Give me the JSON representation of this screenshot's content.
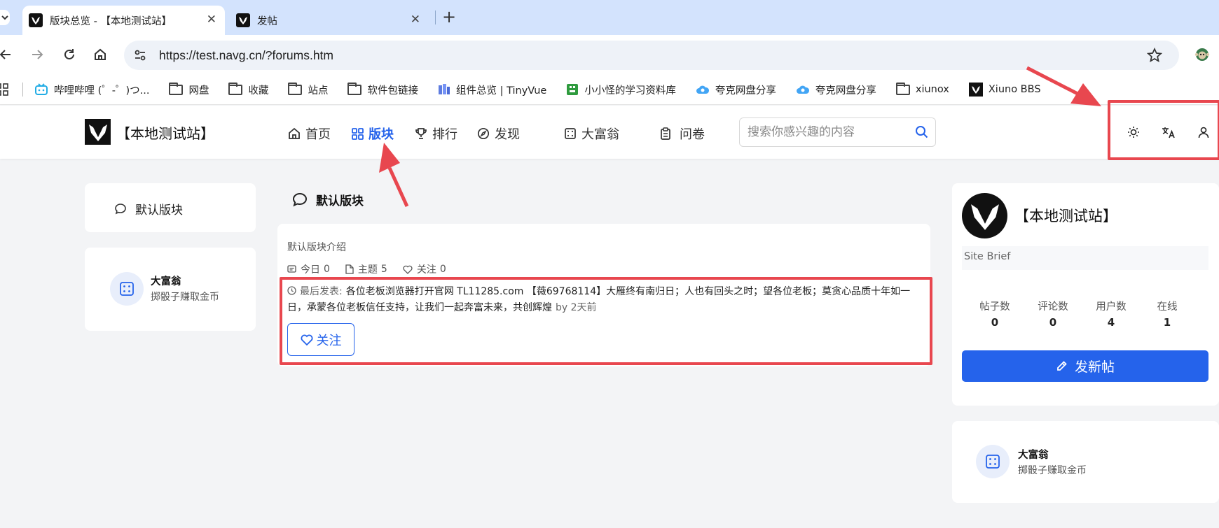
{
  "browser": {
    "tabs": [
      {
        "title": "版块总览 - 【本地测试站】",
        "active": true
      },
      {
        "title": "发帖",
        "active": false
      }
    ],
    "new_tab_symbol": "+",
    "close_symbol": "✕",
    "url": "https://test.navg.cn/?forums.htm",
    "bookmarks": [
      {
        "icon": "bilibili-icon",
        "label": "哔哩哔哩 (゜-゜)つ..."
      },
      {
        "icon": "folder-icon",
        "label": "网盘"
      },
      {
        "icon": "folder-icon",
        "label": "收藏"
      },
      {
        "icon": "folder-icon",
        "label": "站点"
      },
      {
        "icon": "folder-icon",
        "label": "软件包链接"
      },
      {
        "icon": "tinyvue-icon",
        "label": "组件总览 | TinyVue"
      },
      {
        "icon": "green-square-icon",
        "label": "小小怪的学习资料库"
      },
      {
        "icon": "cloud-icon",
        "label": "夸克网盘分享"
      },
      {
        "icon": "cloud-icon",
        "label": "夸克网盘分享"
      },
      {
        "icon": "folder-icon",
        "label": "xiunox"
      },
      {
        "icon": "xiuno-logo-icon",
        "label": "Xiuno BBS"
      }
    ]
  },
  "site": {
    "name": "【本地测试站】",
    "nav": [
      {
        "icon": "home-icon",
        "label": "首页",
        "active": false
      },
      {
        "icon": "grid-icon",
        "label": "版块",
        "active": true
      },
      {
        "icon": "trophy-icon",
        "label": "排行",
        "active": false
      },
      {
        "icon": "compass-icon",
        "label": "发现",
        "active": false
      },
      {
        "icon": "dice-icon",
        "label": "大富翁",
        "active": false
      },
      {
        "icon": "clipboard-icon",
        "label": "问卷",
        "active": false
      }
    ],
    "search_placeholder": "搜索你感兴趣的内容",
    "header_icons": [
      "sun-icon",
      "translate-icon",
      "user-icon"
    ]
  },
  "left_sidebar": {
    "forum_item": "默认版块",
    "widget": {
      "title": "大富翁",
      "subtitle": "掷骰子赚取金币"
    }
  },
  "main": {
    "forum_title": "默认版块",
    "forum_intro": "默认版块介绍",
    "stats": {
      "today_label": "今日",
      "today": "0",
      "topics_label": "主题",
      "topics": "5",
      "follows_label": "关注",
      "follows": "0"
    },
    "last_post_label": "最后发表:",
    "last_post_text": "各位老板浏览器打开官网 TL11285.com 【薇69768114】大雁终有南归日；人也有回头之时；望各位老板；莫贪心品质十年如一日，承蒙各位老板信任支持，让我们一起奔富未来，共创辉煌",
    "last_post_time": "by 2天前",
    "follow_button": "关注"
  },
  "right_sidebar": {
    "site_name": "【本地测试站】",
    "brief": "Site Brief",
    "stats": [
      {
        "label": "帖子数",
        "value": "0"
      },
      {
        "label": "评论数",
        "value": "0"
      },
      {
        "label": "用户数",
        "value": "4"
      },
      {
        "label": "在线",
        "value": "1"
      }
    ],
    "new_post_button": "发新帖",
    "widget": {
      "title": "大富翁",
      "subtitle": "掷骰子赚取金币"
    }
  },
  "colors": {
    "accent": "#2563eb",
    "annotation": "#e8474f"
  }
}
